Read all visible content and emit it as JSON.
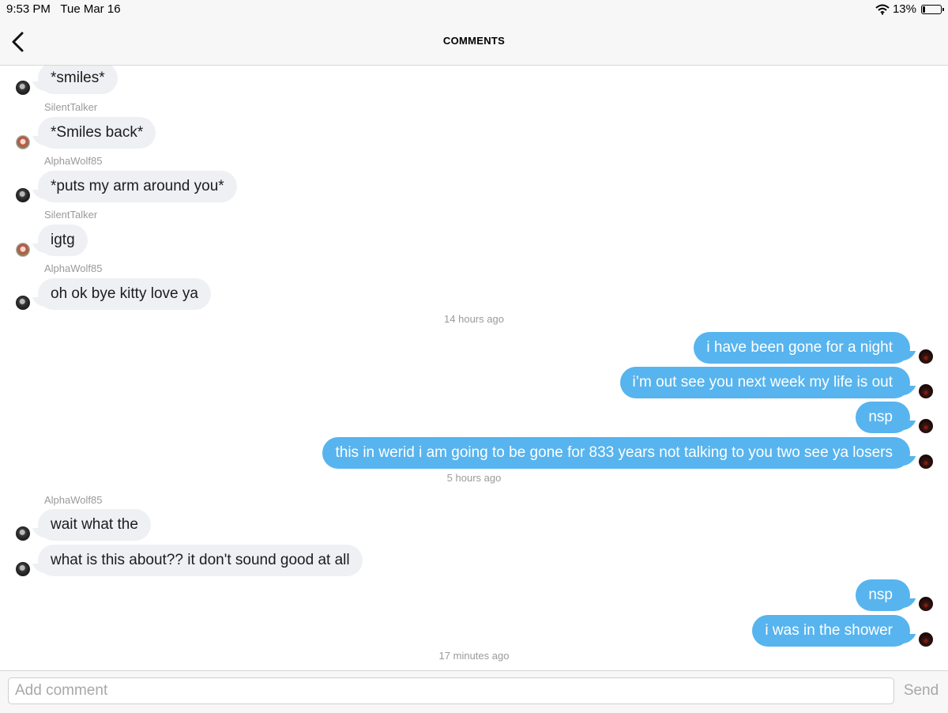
{
  "status_bar": {
    "time": "9:53 PM",
    "date": "Tue Mar 16",
    "battery": "13%",
    "battery_level": 0.13
  },
  "header": {
    "title": "COMMENTS",
    "back_icon": "chevron-left-icon"
  },
  "feed": {
    "messages": [
      {
        "text": "*smiles*",
        "sender": "AlphaWolf85",
        "direction": "incoming"
      },
      {
        "username": "SilentTalker"
      },
      {
        "text": "*Smiles back*",
        "sender": "SilentTalker",
        "direction": "incoming"
      },
      {
        "username": "AlphaWolf85"
      },
      {
        "text": "*puts my arm around you*",
        "sender": "AlphaWolf85",
        "direction": "incoming"
      },
      {
        "username": "SilentTalker"
      },
      {
        "text": "igtg",
        "sender": "SilentTalker",
        "direction": "incoming"
      },
      {
        "username": "AlphaWolf85"
      },
      {
        "text": "oh ok bye kitty love ya",
        "sender": "AlphaWolf85",
        "direction": "incoming"
      },
      {
        "timestamp": "14 hours ago"
      },
      {
        "text": "i have been gone for a night",
        "direction": "outgoing"
      },
      {
        "text": "i’m out see you next week my life is out",
        "direction": "outgoing"
      },
      {
        "text": "nsp",
        "direction": "outgoing"
      },
      {
        "text": "this in werid i am going to be gone for 833 years not talking to you two see ya losers",
        "direction": "outgoing"
      },
      {
        "timestamp": "5 hours ago"
      },
      {
        "username": "AlphaWolf85"
      },
      {
        "text": "wait what the",
        "sender": "AlphaWolf85",
        "direction": "incoming"
      },
      {
        "text": "what is this about?? it don't sound good at all",
        "sender": "AlphaWolf85",
        "direction": "incoming"
      },
      {
        "text": "nsp",
        "direction": "outgoing"
      },
      {
        "text": "i was in the shower",
        "direction": "outgoing"
      },
      {
        "timestamp": "17 minutes ago"
      }
    ]
  },
  "composer": {
    "placeholder": "Add comment",
    "value": "",
    "send_label": "Send"
  },
  "colors": {
    "outgoing_bubble": "#57b4ee",
    "incoming_bubble": "#eef0f3",
    "muted_text": "#9a9a9a"
  }
}
